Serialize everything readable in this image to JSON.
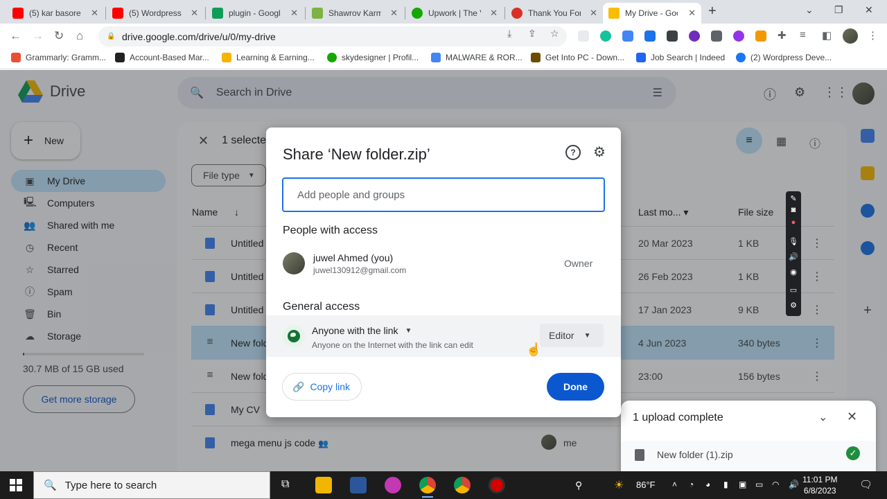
{
  "browser": {
    "tabs": [
      {
        "title": "(5) kar basore",
        "color": "#ff0000"
      },
      {
        "title": "(5) Wordpress",
        "color": "#ff0000"
      },
      {
        "title": "plugin - Googl",
        "color": "#0f9d58"
      },
      {
        "title": "Shawrov Karm",
        "color": "#7cb342"
      },
      {
        "title": "Upwork | The V",
        "color": "#14a800"
      },
      {
        "title": "Thank You For",
        "color": "#d93025"
      },
      {
        "title": "My Drive - Goo",
        "color": "#fbbc04"
      }
    ],
    "url": "drive.google.com/drive/u/0/my-drive",
    "bookmarks": [
      {
        "label": "Grammarly: Gramm...",
        "color": "#e94f35"
      },
      {
        "label": "Account-Based Mar...",
        "color": "#222222"
      },
      {
        "label": "Learning & Earning...",
        "color": "#f4b400"
      },
      {
        "label": "skydesigner | Profil...",
        "color": "#14a800"
      },
      {
        "label": "MALWARE & ROR...",
        "color": "#4285f4"
      },
      {
        "label": "Get Into PC - Down...",
        "color": "#6d4c00"
      },
      {
        "label": "Job Search | Indeed",
        "color": "#2164f3"
      },
      {
        "label": "(2) Wordpress Deve...",
        "color": "#1877f2"
      }
    ]
  },
  "drive": {
    "brand": "Drive",
    "search_placeholder": "Search in Drive",
    "new_label": "New",
    "nav": [
      {
        "label": "My Drive",
        "icon": "drive-icon",
        "glyph": "▣"
      },
      {
        "label": "Computers",
        "icon": "computer-icon",
        "glyph": "🖳"
      },
      {
        "label": "Shared with me",
        "icon": "people-icon",
        "glyph": "👥"
      },
      {
        "label": "Recent",
        "icon": "clock-icon",
        "glyph": "◷"
      },
      {
        "label": "Starred",
        "icon": "star-icon",
        "glyph": "☆"
      },
      {
        "label": "Spam",
        "icon": "spam-icon",
        "glyph": "ⓘ"
      },
      {
        "label": "Bin",
        "icon": "bin-icon",
        "glyph": "🗑"
      },
      {
        "label": "Storage",
        "icon": "cloud-icon",
        "glyph": "☁"
      }
    ],
    "storage_text": "30.7 MB of 15 GB used",
    "storage_fraction": 0.002,
    "get_storage": "Get more storage",
    "selection_text": "1 selecte",
    "file_type_label": "File type",
    "columns": {
      "name": "Name",
      "modified": "Last mo...",
      "size": "File size"
    },
    "files": [
      {
        "name": "Untitled",
        "modified": "20 Mar 2023",
        "size": "1 KB",
        "kind": "doc"
      },
      {
        "name": "Untitled",
        "modified": "26 Feb 2023",
        "size": "1 KB",
        "kind": "doc"
      },
      {
        "name": "Untitled",
        "modified": "17 Jan 2023",
        "size": "9 KB",
        "kind": "doc"
      },
      {
        "name": "New fold",
        "modified": "4 Jun 2023",
        "size": "340 bytes",
        "kind": "zip"
      },
      {
        "name": "New fold",
        "modified": "23:00",
        "size": "156 bytes",
        "kind": "zip"
      },
      {
        "name": "My CV",
        "modified": "",
        "size": "",
        "kind": "doc"
      },
      {
        "name": "mega menu js code",
        "modified": "",
        "size": "",
        "kind": "doc",
        "owner": "me"
      }
    ]
  },
  "share": {
    "title": "Share ‘New folder.zip’",
    "input_placeholder": "Add people and groups",
    "people_heading": "People with access",
    "person": {
      "name": "juwel Ahmed (you)",
      "email": "juwel130912@gmail.com",
      "role": "Owner"
    },
    "general_heading": "General access",
    "access_type": "Anyone with the link",
    "access_desc": "Anyone on the Internet with the link can edit",
    "access_role": "Editor",
    "copy_link": "Copy link",
    "done": "Done"
  },
  "upload": {
    "title": "1 upload complete",
    "file": "New folder (1).zip"
  },
  "taskbar": {
    "search_placeholder": "Type here to search",
    "weather": "86°F",
    "time": "11:01 PM",
    "date": "6/8/2023"
  }
}
